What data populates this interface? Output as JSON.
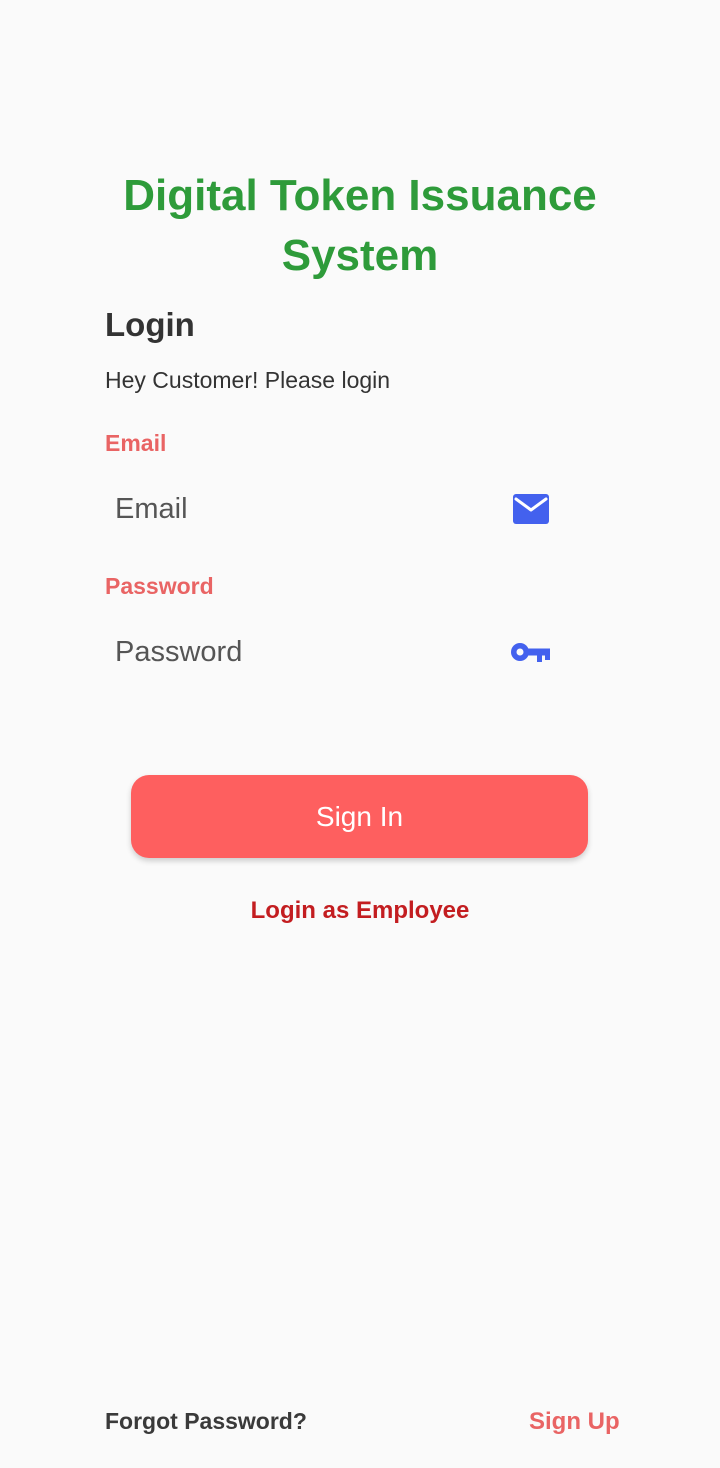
{
  "app": {
    "title": "Digital Token Issuance System"
  },
  "login": {
    "heading": "Login",
    "subtitle": "Hey Customer! Please login"
  },
  "email_field": {
    "label": "Email",
    "placeholder": "Email",
    "value": "",
    "icon": "mail-icon"
  },
  "password_field": {
    "label": "Password",
    "placeholder": "Password",
    "value": "",
    "icon": "key-icon"
  },
  "actions": {
    "sign_in_label": "Sign In",
    "employee_link_label": "Login as Employee",
    "forgot_password_label": "Forgot Password?",
    "sign_up_label": "Sign Up"
  },
  "colors": {
    "title_green": "#2e9b3a",
    "label_red": "#e96464",
    "button_red": "#fe5f5f",
    "employee_link_red": "#c31d20",
    "icon_blue": "#4361ee",
    "background": "#fafafa"
  }
}
